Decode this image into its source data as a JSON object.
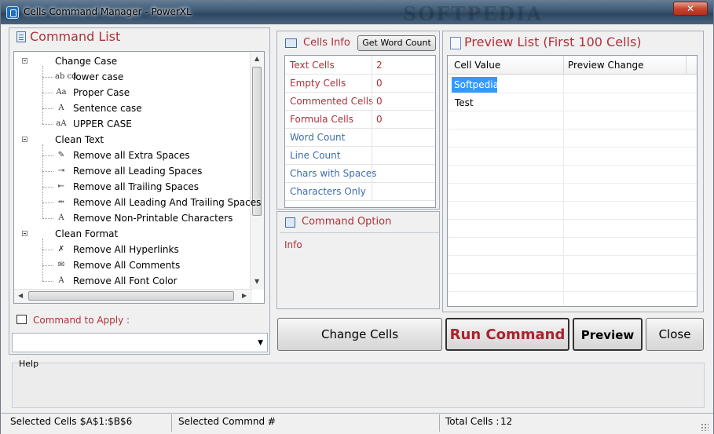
{
  "window": {
    "title": "Cells Command Manager - PowerXL",
    "watermark": "SOFTPEDIA",
    "close_symbol": "✕"
  },
  "command_list": {
    "title": "Command List",
    "groups": [
      {
        "label": "Change Case",
        "items": [
          {
            "label": "lower case",
            "icon": "lowercase-ab-cd-icon",
            "glyph": "ab cd"
          },
          {
            "label": "Proper Case",
            "icon": "proper-case-aa-icon",
            "glyph": "Aa"
          },
          {
            "label": "Sentence case",
            "icon": "sentence-case-a-icon",
            "glyph": "A"
          },
          {
            "label": "UPPER CASE",
            "icon": "uppercase-aa-icon",
            "glyph": "aA"
          }
        ]
      },
      {
        "label": "Clean Text",
        "items": [
          {
            "label": "Remove all Extra Spaces",
            "icon": "eraser-icon",
            "glyph": "✎"
          },
          {
            "label": "Remove all Leading Spaces",
            "icon": "indent-icon",
            "glyph": "⇥"
          },
          {
            "label": "Remove all Trailing Spaces",
            "icon": "outdent-icon",
            "glyph": "⇤"
          },
          {
            "label": "Remove All Leading And Trailing Spaces",
            "icon": "trim-both-icon",
            "glyph": "⇹"
          },
          {
            "label": "Remove Non-Printable Characters",
            "icon": "nonprintable-icon",
            "glyph": "A"
          }
        ]
      },
      {
        "label": "Clean Format",
        "items": [
          {
            "label": "Remove All Hyperlinks",
            "icon": "unlink-icon",
            "glyph": "✗"
          },
          {
            "label": "Remove All Comments",
            "icon": "comment-remove-icon",
            "glyph": "✉"
          },
          {
            "label": "Remove All Font Color",
            "icon": "font-color-icon",
            "glyph": "A"
          }
        ]
      }
    ]
  },
  "command_to_apply": {
    "label": "Command to Apply :",
    "value": "",
    "dropdown_arrow": "▼"
  },
  "cells_info": {
    "title": "Cells Info",
    "get_word_count_label": "Get Word Count",
    "rows": [
      {
        "label": "Text Cells",
        "value": "2",
        "color": "red"
      },
      {
        "label": "Empty Cells",
        "value": "0",
        "color": "red"
      },
      {
        "label": "Commented Cells",
        "value": "0",
        "color": "red"
      },
      {
        "label": "Formula Cells",
        "value": "0",
        "color": "red"
      },
      {
        "label": "Word Count",
        "value": "",
        "color": "blue"
      },
      {
        "label": "Line Count",
        "value": "",
        "color": "blue"
      },
      {
        "label": "Chars with Spaces",
        "value": "",
        "color": "blue"
      },
      {
        "label": "Characters Only",
        "value": "",
        "color": "blue"
      }
    ]
  },
  "command_option": {
    "title": "Command Option",
    "info": "Info"
  },
  "preview_list": {
    "title": "Preview List (First 100 Cells)",
    "columns": [
      "Cell Value",
      "Preview Change"
    ],
    "rows": [
      {
        "value": "Softpedia",
        "change": "",
        "selected": true
      },
      {
        "value": "Test",
        "change": "",
        "selected": false
      }
    ]
  },
  "buttons": {
    "change_cells": "Change Cells",
    "run_command": "Run Command",
    "preview": "Preview",
    "close": "Close"
  },
  "help": {
    "label": "Help",
    "text": ""
  },
  "status_bar": {
    "selected_cells_label": "Selected Cells :",
    "selected_cells_value": "$A$1:$B$6",
    "selected_command_label": "Selected Commnd :",
    "selected_command_value": "#",
    "total_cells_label": "Total Cells :",
    "total_cells_value": "12"
  },
  "colors": {
    "accent_red": "#b0303a",
    "accent_blue": "#3d6cae",
    "selection": "#3399ff"
  }
}
